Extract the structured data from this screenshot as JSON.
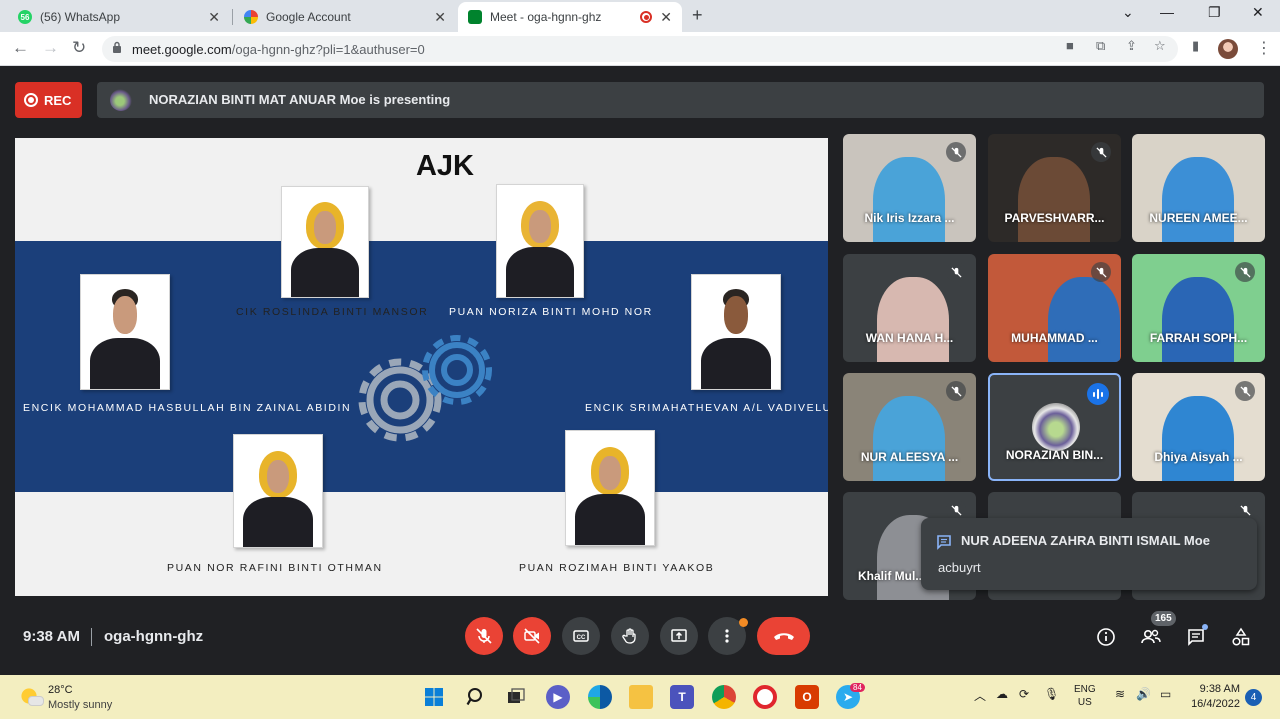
{
  "browser": {
    "tabs": [
      {
        "label": "(56) WhatsApp",
        "favicon": "whatsapp-icon",
        "count": "56",
        "active": false
      },
      {
        "label": "Google Account",
        "favicon": "google-icon",
        "active": false
      },
      {
        "label": "Meet - oga-hgnn-ghz",
        "favicon": "meet-icon",
        "active": true
      }
    ],
    "url_main": "meet.google.com",
    "url_rest": "/oga-hgnn-ghz?pli=1&authuser=0"
  },
  "meet": {
    "rec_label": "REC",
    "presenting_text": "NORAZIAN BINTI MAT ANUAR Moe is presenting",
    "slide": {
      "title": "AJK",
      "names": {
        "p1": "CIK ROSLINDA BINTI MANSOR",
        "p2": "PUAN NORIZA BINTI MOHD NOR",
        "p3": "ENCIK MOHAMMAD HASBULLAH BIN ZAINAL ABIDIN",
        "p4": "ENCIK SRIMAHATHEVAN A/L VADIVELU",
        "p5": "PUAN NOR RAFINI BINTI OTHMAN",
        "p6": "PUAN ROZIMAH BINTI YAAKOB"
      }
    },
    "participants": [
      {
        "name": "Nik Iris Izzara ..."
      },
      {
        "name": "PARVESHVARR..."
      },
      {
        "name": "NUREEN AMEE..."
      },
      {
        "name": "WAN HANA H..."
      },
      {
        "name": "MUHAMMAD ..."
      },
      {
        "name": "FARRAH SOPH..."
      },
      {
        "name": "NUR ALEESYA ..."
      },
      {
        "name": "NORAZIAN BIN..."
      },
      {
        "name": "Dhiya Aisyah ..."
      },
      {
        "name": "Khalif Mul..."
      }
    ],
    "chat_toast": {
      "sender": "NUR ADEENA ZAHRA BINTI ISMAIL Moe",
      "message": "acbuyrt"
    },
    "bottom": {
      "time": "9:38 AM",
      "meeting_code": "oga-hgnn-ghz",
      "people_count": "165"
    },
    "colors": {
      "danger": "#ea4335",
      "active_border": "#8ab4f8",
      "background": "#202124"
    }
  },
  "taskbar": {
    "temperature": "28°C",
    "condition": "Mostly sunny",
    "lang_top": "ENG",
    "lang_bottom": "US",
    "time": "9:38 AM",
    "date": "16/4/2022",
    "notification_count": "4",
    "app_badge": "84"
  }
}
